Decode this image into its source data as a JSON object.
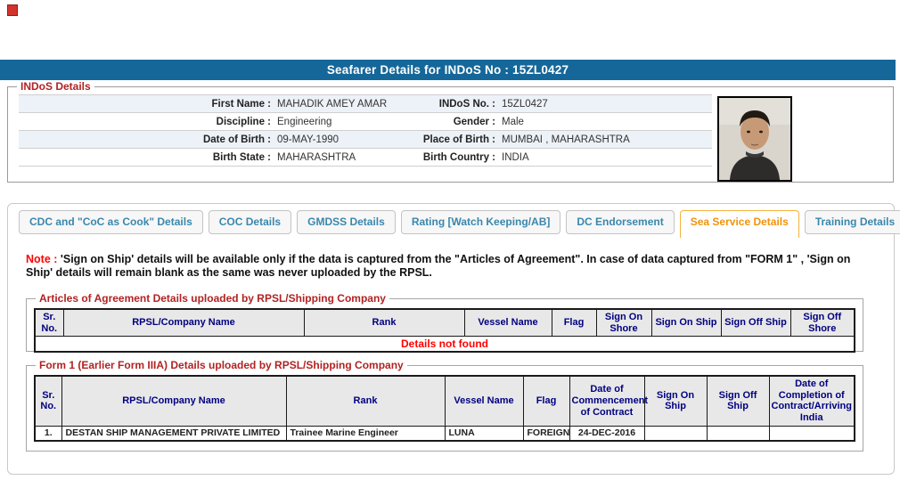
{
  "page": {
    "title": "Seafarer Details for INDoS No : 15ZL0427"
  },
  "colors": {
    "title_bar": "#15679a",
    "legend_red": "#b22222",
    "note_red": "#ff0000",
    "table_header_navy": "#000080",
    "tab_blue": "#3a87ad",
    "tab_active_orange": "#f0940a",
    "row_stripe": "#edf2f8"
  },
  "indos_details": {
    "legend": "INDoS Details",
    "rows": [
      {
        "l1": "First Name :",
        "v1": "MAHADIK AMEY AMAR",
        "l2": "INDoS No. :",
        "v2": "15ZL0427"
      },
      {
        "l1": "Discipline :",
        "v1": "Engineering",
        "l2": "Gender :",
        "v2": "Male"
      },
      {
        "l1": "Date of Birth :",
        "v1": "09-MAY-1990",
        "l2": "Place of Birth :",
        "v2": "MUMBAI , MAHARASHTRA"
      },
      {
        "l1": "Birth State :",
        "v1": "MAHARASHTRA",
        "l2": "Birth Country :",
        "v2": "INDIA"
      }
    ],
    "photo_alt": "seafarer-photo"
  },
  "tabs": {
    "active_tab": "Sea Service Details",
    "items": [
      {
        "label": "CDC and \"CoC as Cook\" Details"
      },
      {
        "label": "COC Details"
      },
      {
        "label": "GMDSS Details"
      },
      {
        "label": "Rating [Watch Keeping/AB]"
      },
      {
        "label": "DC Endorsement"
      },
      {
        "label": "Sea Service Details"
      },
      {
        "label": "Training Details"
      }
    ]
  },
  "note": {
    "prefix": "Note :",
    "text": " 'Sign on Ship' details will be available only if the data is captured from the \"Articles of Agreement\". In case of data captured from \"FORM 1\" , 'Sign on Ship' details will remain blank as the same was never uploaded by the RPSL."
  },
  "articles_table": {
    "legend": "Articles of Agreement Details uploaded by RPSL/Shipping Company",
    "headers": [
      "Sr. No.",
      "RPSL/Company Name",
      "Rank",
      "Vessel Name",
      "Flag",
      "Sign On Shore",
      "Sign On Ship",
      "Sign Off Ship",
      "Sign Off Shore"
    ],
    "empty_message": "Details not found"
  },
  "form1_table": {
    "legend": "Form 1 (Earlier Form IIIA) Details uploaded by RPSL/Shipping Company",
    "headers": [
      "Sr. No.",
      "RPSL/Company Name",
      "Rank",
      "Vessel Name",
      "Flag",
      "Date of Commencement of Contract",
      "Sign On Ship",
      "Sign Off Ship",
      "Date of Completion of Contract/Arriving India"
    ],
    "rows": [
      {
        "sr": "1.",
        "company": "DESTAN SHIP MANAGEMENT PRIVATE LIMITED",
        "rank": "Trainee Marine Engineer",
        "vessel": "LUNA",
        "flag": "FOREIGN",
        "commencement": "24-DEC-2016",
        "sign_on_ship": "",
        "sign_off_ship": "",
        "completion": ""
      }
    ]
  }
}
